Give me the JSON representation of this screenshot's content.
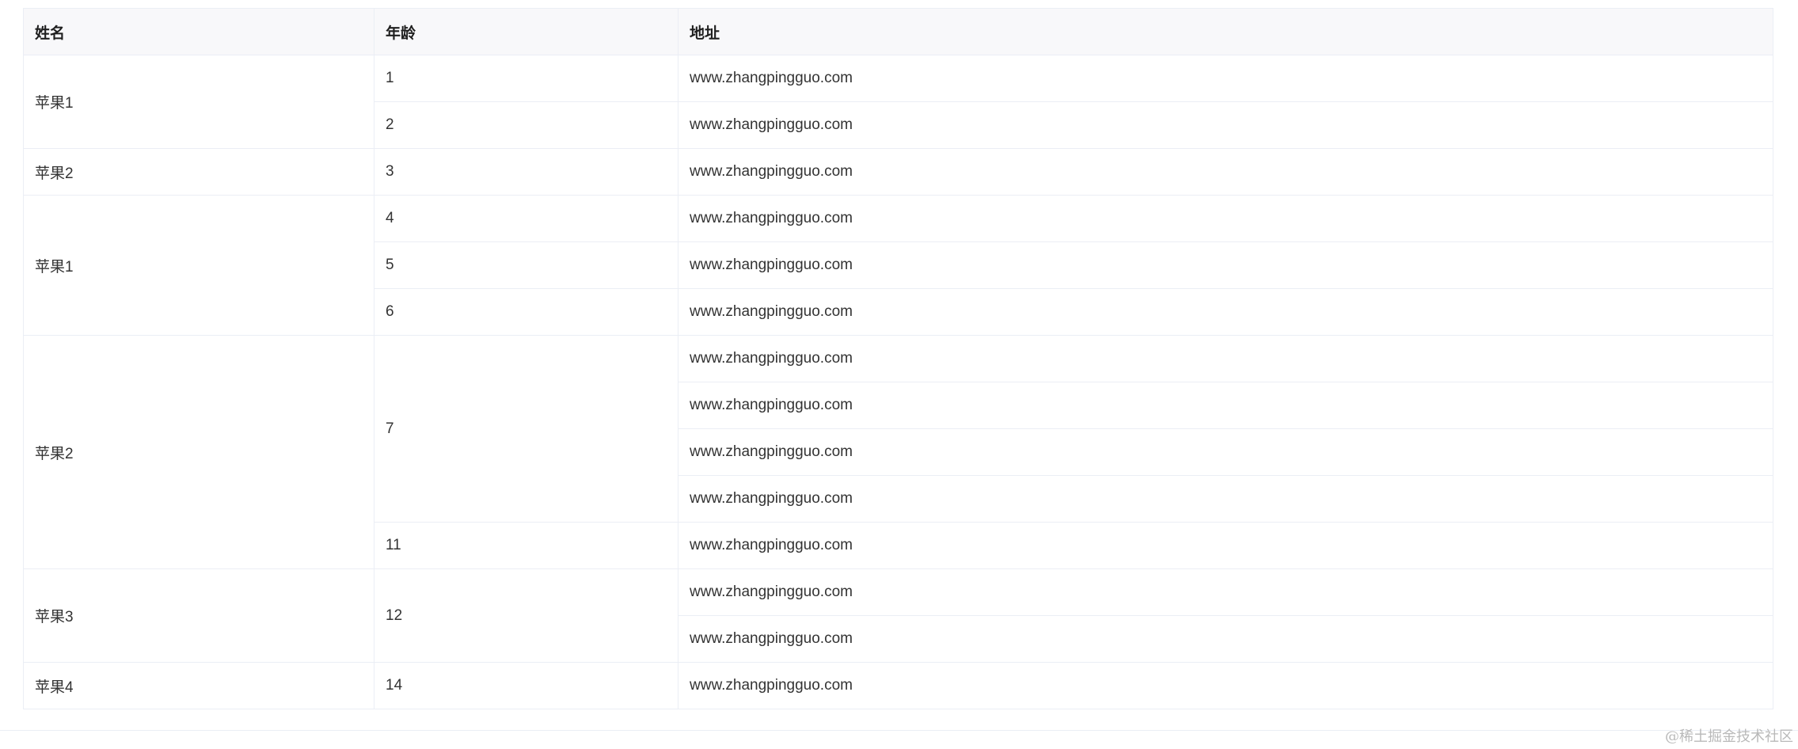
{
  "table": {
    "headers": {
      "name": "姓名",
      "age": "年龄",
      "address": "地址"
    },
    "rows": [
      {
        "name": "苹果1",
        "age": "1",
        "address": "www.zhangpingguo.com"
      },
      {
        "age": "2",
        "address": "www.zhangpingguo.com"
      },
      {
        "name": "苹果2",
        "age": "3",
        "address": "www.zhangpingguo.com"
      },
      {
        "name": "苹果1",
        "age": "4",
        "address": "www.zhangpingguo.com"
      },
      {
        "age": "5",
        "address": "www.zhangpingguo.com"
      },
      {
        "age": "6",
        "address": "www.zhangpingguo.com"
      },
      {
        "name": "苹果2",
        "age": "7",
        "address": "www.zhangpingguo.com"
      },
      {
        "address": "www.zhangpingguo.com"
      },
      {
        "address": "www.zhangpingguo.com"
      },
      {
        "address": "www.zhangpingguo.com"
      },
      {
        "age": "11",
        "address": "www.zhangpingguo.com"
      },
      {
        "name": "苹果3",
        "age": "12",
        "address": "www.zhangpingguo.com"
      },
      {
        "address": "www.zhangpingguo.com"
      },
      {
        "name": "苹果4",
        "age": "14",
        "address": "www.zhangpingguo.com"
      }
    ]
  },
  "watermark": "@稀土掘金技术社区"
}
